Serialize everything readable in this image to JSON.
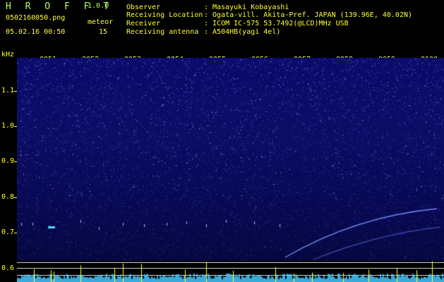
{
  "header": {
    "app_title": "H R O F F T",
    "app_version": "1.0.0",
    "file_name": "0502160050.png",
    "timestamp": "05.02.16 00:50",
    "meteor_label": "meteor",
    "meteor_count": "15"
  },
  "info": [
    {
      "key": "Observer",
      "value": ": Masayuki Kobayashi"
    },
    {
      "key": "Receiving Location",
      "value": ": Ogata-vill. Akita-Pref. JAPAN (139.96E, 40.02N)"
    },
    {
      "key": "Receiver",
      "value": ": ICOM IC-575 53.7492(@LCD)MHz USB"
    },
    {
      "key": "Receiving antenna",
      "value": ": A504HB(yagi 4el)"
    }
  ],
  "axis": {
    "y_unit": "kHz",
    "y_ticks": [
      "1.1",
      "1.0",
      "0.9",
      "0.8",
      "0.7",
      "0.6"
    ],
    "x_ticks": [
      "0051",
      "0052",
      "0053",
      "0054",
      "0055",
      "0056",
      "0057",
      "0058",
      "0059",
      "0100"
    ]
  },
  "colors": {
    "background": "#000000",
    "label_yellow": "#ffff33",
    "title_green": "#b4ff5a",
    "spectrogram_blue": "#0a0b6a",
    "signal_cyan": "#3fe0ff"
  }
}
